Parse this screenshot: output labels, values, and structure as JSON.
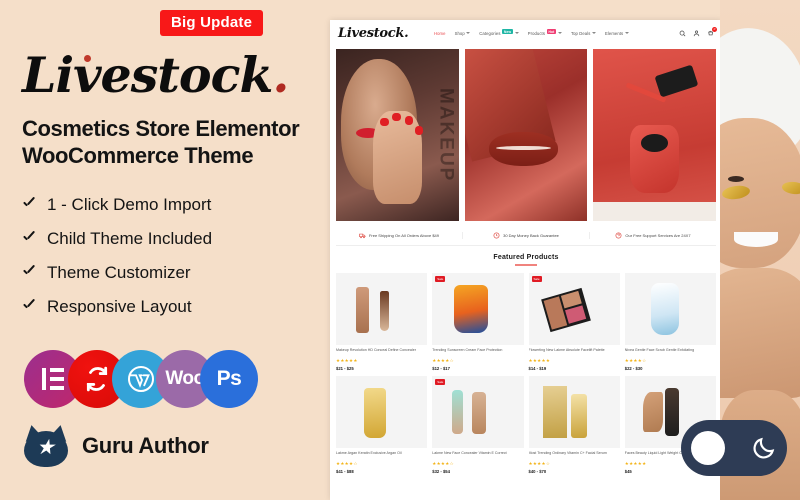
{
  "promo": {
    "badge": "Big Update",
    "brand": "Livestock",
    "brand_suffix": ".",
    "headline_line1": "Cosmetics Store Elementor",
    "headline_line2": "WooCommerce Theme",
    "features": [
      "1 - Click Demo Import",
      "Child Theme Included",
      "Theme Customizer",
      "Responsive Layout"
    ],
    "tech_badges": [
      {
        "name": "elementor",
        "label": "",
        "color": "#9b2f8f"
      },
      {
        "name": "sync",
        "label": "",
        "color": "#e01010"
      },
      {
        "name": "wordpress",
        "label": "W",
        "color": "#34a3d8"
      },
      {
        "name": "woocommerce",
        "label": "Woo",
        "color": "#9b6aa8"
      },
      {
        "name": "photoshop",
        "label": "Ps",
        "color": "#2a6fdb"
      }
    ],
    "author_label": "Guru Author",
    "accent_red": "#f81818",
    "background": "#f5dfc9"
  },
  "site": {
    "logo": "Livestock.",
    "nav": [
      {
        "label": "Home",
        "active": true,
        "caret": false,
        "badge": "",
        "badge_color": ""
      },
      {
        "label": "Shop",
        "active": false,
        "caret": true,
        "badge": "",
        "badge_color": ""
      },
      {
        "label": "Categories",
        "active": false,
        "caret": true,
        "badge": "New",
        "badge_color": "teal"
      },
      {
        "label": "Products",
        "active": false,
        "caret": true,
        "badge": "Hot",
        "badge_color": "pink"
      },
      {
        "label": "Top Deals",
        "active": false,
        "caret": true,
        "badge": "",
        "badge_color": ""
      },
      {
        "label": "Elements",
        "active": false,
        "caret": true,
        "badge": "",
        "badge_color": ""
      }
    ],
    "header_icons": [
      "search-icon",
      "account-icon",
      "cart-icon"
    ],
    "cart_count": "0",
    "hero": [
      {
        "name": "makeup-model-banner",
        "overlay_word": "MAKEUP"
      },
      {
        "name": "red-lips-banner",
        "overlay_word": ""
      },
      {
        "name": "nail-polish-banner",
        "overlay_word": ""
      }
    ],
    "services": [
      {
        "icon": "shipping-icon",
        "text": "Free Shipping On All Orders Above $49"
      },
      {
        "icon": "money-back-icon",
        "text": "30 Day Money Back Guarantee"
      },
      {
        "icon": "support-icon",
        "text": "Our Free Support Services Are 24X7"
      }
    ],
    "featured_title": "Featured Products",
    "products": [
      {
        "title": "Makeup Revolution HD Conceal Define Concealer",
        "stars": "★★★★★",
        "price": "$21 - $25",
        "sale": ""
      },
      {
        "title": "Trending Sunscreen Cream Face Protection",
        "stars": "★★★★☆",
        "price": "$12 - $17",
        "sale": "Sale"
      },
      {
        "title": "Flowerting New Lakme Absolute Facelift Palette",
        "stars": "★★★★★",
        "price": "$14 - $19",
        "sale": "Sale"
      },
      {
        "title": "Nivea Gentle Face Scrub Gentle Exfoliating",
        "stars": "★★★★☆",
        "price": "$22 - $30",
        "sale": ""
      },
      {
        "title": "Lakme Argan Keratin Exclusive Argan Oil",
        "stars": "★★★★☆",
        "price": "$41 - $88",
        "sale": ""
      },
      {
        "title": "Lakme New Face Concealer Vitamin E Correct",
        "stars": "★★★★☆",
        "price": "$32 - $54",
        "sale": "Sale"
      },
      {
        "title": "Most Trending Ordinary Vitamin C+ Facial Serum",
        "stars": "★★★★☆",
        "price": "$40 - $70",
        "sale": ""
      },
      {
        "title": "Faces Beauty Liquid Light Weight Concealer",
        "stars": "★★★★★",
        "price": "$45",
        "sale": ""
      }
    ]
  },
  "model": {
    "name": "smiling-woman-with-eye-patches"
  },
  "toggle": {
    "name": "dark-mode-toggle",
    "state": "light",
    "moon_icon": "moon-icon",
    "background": "#2e3c55"
  }
}
